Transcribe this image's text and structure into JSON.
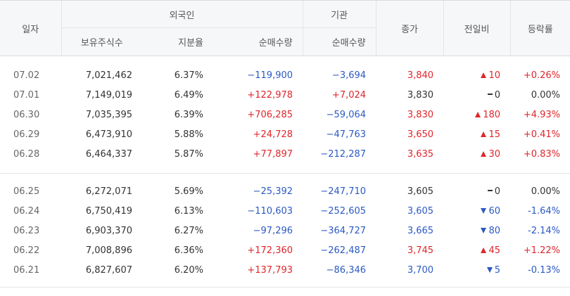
{
  "header": {
    "date": "일자",
    "foreign": "외국인",
    "institution": "기관",
    "close": "종가",
    "change": "전일비",
    "rate": "등락률",
    "holdings": "보유주식수",
    "share": "지분율",
    "foreign_net": "순매수량",
    "inst_net": "순매수량"
  },
  "colors": {
    "up": "#e0252b",
    "down": "#2b59c3",
    "neutral": "#333333"
  },
  "groups": [
    [
      {
        "date": "07.02",
        "holdings": "7,021,462",
        "share": "6.37%",
        "foreign_net": "−119,900",
        "foreign_dir": "down",
        "inst_net": "−3,694",
        "inst_dir": "down",
        "close": "3,840",
        "close_dir": "up",
        "change": "10",
        "change_dir": "up",
        "rate": "+0.26%",
        "rate_dir": "up"
      },
      {
        "date": "07.01",
        "holdings": "7,149,019",
        "share": "6.49%",
        "foreign_net": "+122,978",
        "foreign_dir": "up",
        "inst_net": "+7,024",
        "inst_dir": "up",
        "close": "3,830",
        "close_dir": "flat",
        "change": "0",
        "change_dir": "flat",
        "rate": "0.00%",
        "rate_dir": "flat"
      },
      {
        "date": "06.30",
        "holdings": "7,035,395",
        "share": "6.39%",
        "foreign_net": "+706,285",
        "foreign_dir": "up",
        "inst_net": "−59,064",
        "inst_dir": "down",
        "close": "3,830",
        "close_dir": "up",
        "change": "180",
        "change_dir": "up",
        "rate": "+4.93%",
        "rate_dir": "up"
      },
      {
        "date": "06.29",
        "holdings": "6,473,910",
        "share": "5.88%",
        "foreign_net": "+24,728",
        "foreign_dir": "up",
        "inst_net": "−47,763",
        "inst_dir": "down",
        "close": "3,650",
        "close_dir": "up",
        "change": "15",
        "change_dir": "up",
        "rate": "+0.41%",
        "rate_dir": "up"
      },
      {
        "date": "06.28",
        "holdings": "6,464,337",
        "share": "5.87%",
        "foreign_net": "+77,897",
        "foreign_dir": "up",
        "inst_net": "−212,287",
        "inst_dir": "down",
        "close": "3,635",
        "close_dir": "up",
        "change": "30",
        "change_dir": "up",
        "rate": "+0.83%",
        "rate_dir": "up"
      }
    ],
    [
      {
        "date": "06.25",
        "holdings": "6,272,071",
        "share": "5.69%",
        "foreign_net": "−25,392",
        "foreign_dir": "down",
        "inst_net": "−247,710",
        "inst_dir": "down",
        "close": "3,605",
        "close_dir": "flat",
        "change": "0",
        "change_dir": "flat",
        "rate": "0.00%",
        "rate_dir": "flat"
      },
      {
        "date": "06.24",
        "holdings": "6,750,419",
        "share": "6.13%",
        "foreign_net": "−110,603",
        "foreign_dir": "down",
        "inst_net": "−252,605",
        "inst_dir": "down",
        "close": "3,605",
        "close_dir": "down",
        "change": "60",
        "change_dir": "down",
        "rate": "-1.64%",
        "rate_dir": "down"
      },
      {
        "date": "06.23",
        "holdings": "6,903,370",
        "share": "6.27%",
        "foreign_net": "−97,296",
        "foreign_dir": "down",
        "inst_net": "−364,727",
        "inst_dir": "down",
        "close": "3,665",
        "close_dir": "down",
        "change": "80",
        "change_dir": "down",
        "rate": "-2.14%",
        "rate_dir": "down"
      },
      {
        "date": "06.22",
        "holdings": "7,008,896",
        "share": "6.36%",
        "foreign_net": "+172,360",
        "foreign_dir": "up",
        "inst_net": "−262,487",
        "inst_dir": "down",
        "close": "3,745",
        "close_dir": "up",
        "change": "45",
        "change_dir": "up",
        "rate": "+1.22%",
        "rate_dir": "up"
      },
      {
        "date": "06.21",
        "holdings": "6,827,607",
        "share": "6.20%",
        "foreign_net": "+137,793",
        "foreign_dir": "up",
        "inst_net": "−86,346",
        "inst_dir": "down",
        "close": "3,700",
        "close_dir": "down",
        "change": "5",
        "change_dir": "down",
        "rate": "-0.13%",
        "rate_dir": "down"
      }
    ]
  ]
}
